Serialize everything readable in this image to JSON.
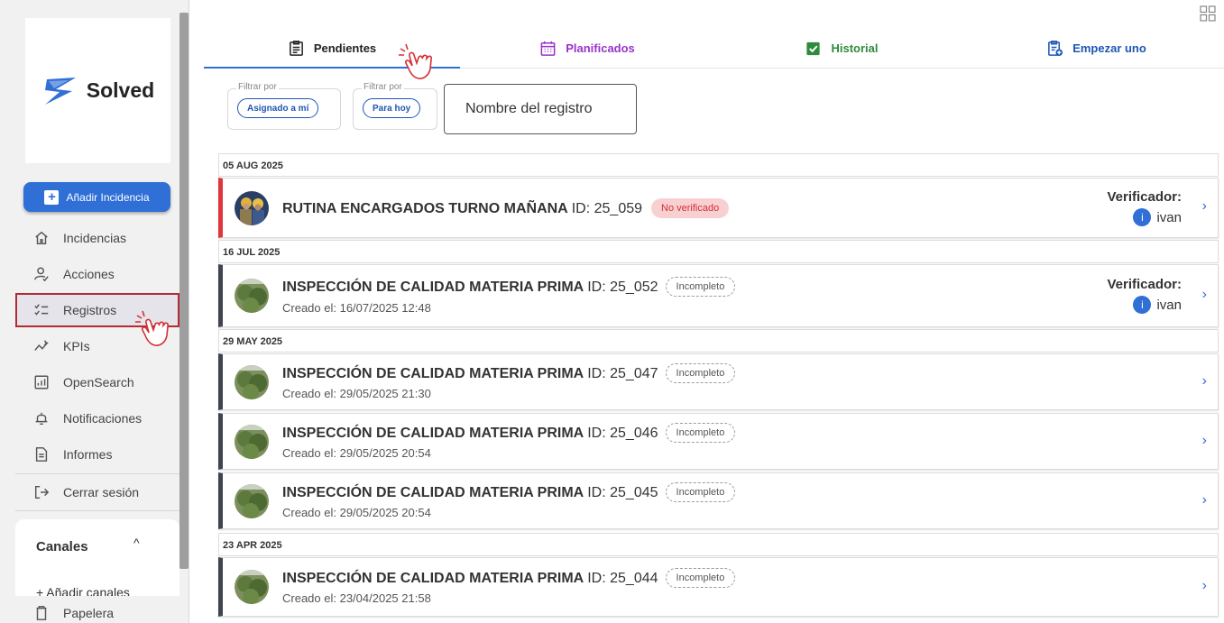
{
  "brand": {
    "name": "Solved",
    "color": "#2f6fd6"
  },
  "sidebar": {
    "add_button": "Añadir Incidencia",
    "items": [
      {
        "label": "Incidencias",
        "icon": "home-icon"
      },
      {
        "label": "Acciones",
        "icon": "user-check-icon"
      },
      {
        "label": "Registros",
        "icon": "checklist-icon",
        "active": true
      },
      {
        "label": "KPIs",
        "icon": "sparkline-icon"
      },
      {
        "label": "OpenSearch",
        "icon": "bar-chart-box-icon"
      },
      {
        "label": "Notificaciones",
        "icon": "bell-icon"
      },
      {
        "label": "Informes",
        "icon": "document-icon"
      },
      {
        "label": "Cerrar sesión",
        "icon": "logout-icon"
      }
    ],
    "canales": {
      "title": "Canales",
      "add": "+ Añadir canales"
    },
    "papelera": "Papelera"
  },
  "tabs": [
    {
      "label": "Pendientes",
      "color": "#222222",
      "active": true
    },
    {
      "label": "Planificados",
      "color": "#9a32c9"
    },
    {
      "label": "Historial",
      "color": "#2e8b3c"
    },
    {
      "label": "Empezar uno",
      "color": "#1e56b4"
    }
  ],
  "filters": {
    "legend": "Filtrar por",
    "chip1": "Asignado a mí",
    "chip2": "Para hoy",
    "name_placeholder": "Nombre del registro"
  },
  "groups": [
    {
      "date": "05 AUG 2025"
    },
    {
      "date": "16 JUL 2025"
    },
    {
      "date": "29 MAY 2025"
    },
    {
      "date": "23 APR 2025"
    }
  ],
  "records": [
    {
      "title": "RUTINA ENCARGADOS TURNO MAÑANA",
      "id": "ID: 25_059",
      "status": "No verificado",
      "created": "",
      "verifier_label": "Verificador:",
      "verifier": "ivan",
      "verifier_initial": "i"
    },
    {
      "title": "INSPECCIÓN DE CALIDAD MATERIA PRIMA",
      "id": "ID: 25_052",
      "status": "Incompleto",
      "created": "Creado el: 16/07/2025 12:48",
      "verifier_label": "Verificador:",
      "verifier": "ivan",
      "verifier_initial": "i"
    },
    {
      "title": "INSPECCIÓN DE CALIDAD MATERIA PRIMA",
      "id": "ID: 25_047",
      "status": "Incompleto",
      "created": "Creado el: 29/05/2025 21:30"
    },
    {
      "title": "INSPECCIÓN DE CALIDAD MATERIA PRIMA",
      "id": "ID: 25_046",
      "status": "Incompleto",
      "created": "Creado el: 29/05/2025 20:54"
    },
    {
      "title": "INSPECCIÓN DE CALIDAD MATERIA PRIMA",
      "id": "ID: 25_045",
      "status": "Incompleto",
      "created": "Creado el: 29/05/2025 20:54"
    },
    {
      "title": "INSPECCIÓN DE CALIDAD MATERIA PRIMA",
      "id": "ID: 25_044",
      "status": "Incompleto",
      "created": "Creado el: 23/04/2025 21:58"
    }
  ],
  "chevron": "›"
}
